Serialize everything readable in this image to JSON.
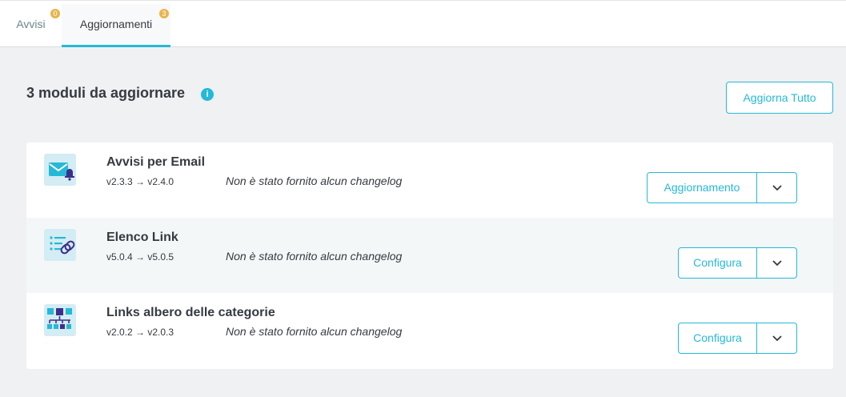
{
  "tabs": [
    {
      "label": "Avvisi",
      "badge": "0",
      "active": false
    },
    {
      "label": "Aggiornamenti",
      "badge": "3",
      "active": true
    }
  ],
  "section": {
    "title": "3 moduli da aggiornare",
    "info_icon": "i",
    "update_all_label": "Aggiorna Tutto"
  },
  "modules": [
    {
      "name": "Avvisi per Email",
      "version": "v2.3.3 → v2.4.0",
      "changelog": "Non è stato fornito alcun changelog",
      "action_label": "Aggiornamento",
      "icon": "email-alert-icon"
    },
    {
      "name": "Elenco Link",
      "version": "v5.0.4 → v5.0.5",
      "changelog": "Non è stato fornito alcun changelog",
      "action_label": "Configura",
      "icon": "link-list-icon"
    },
    {
      "name": "Links albero delle categorie",
      "version": "v2.0.2 → v2.0.3",
      "changelog": "Non è stato fornito alcun changelog",
      "action_label": "Configura",
      "icon": "category-tree-icon"
    }
  ],
  "colors": {
    "accent": "#25b9d7",
    "badge": "#e9b44c",
    "page_bg": "#eff1f2",
    "text": "#363a41"
  }
}
